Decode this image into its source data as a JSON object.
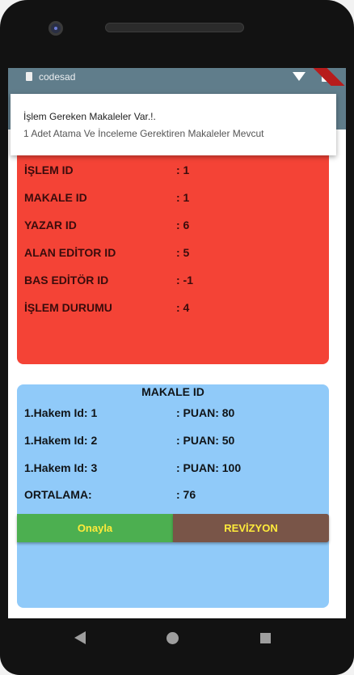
{
  "status_bar": {
    "app_name": "codesad",
    "icons": [
      "app-icon",
      "wifi-icon",
      "battery-icon"
    ]
  },
  "notification": {
    "title": "İşlem Gereken Makaleler Var.!.",
    "body": "1 Adet Atama Ve İnceleme Gerektiren  Makaleler Mevcut"
  },
  "process_card": {
    "color": "#f44336",
    "rows": [
      {
        "label": "İŞLEM ID",
        "value": ": 1"
      },
      {
        "label": "MAKALE ID",
        "value": ": 1"
      },
      {
        "label": "YAZAR ID",
        "value": ": 6"
      },
      {
        "label": "ALAN EDİTOR ID",
        "value": ": 5"
      },
      {
        "label": "BAS EDİTÖR ID",
        "value": ": -1"
      },
      {
        "label": "İŞLEM DURUMU",
        "value": ": 4"
      }
    ]
  },
  "review_card": {
    "color": "#90caf9",
    "title": "MAKALE ID",
    "rows": [
      {
        "label": "1.Hakem Id: 1",
        "value": ":  PUAN: 80"
      },
      {
        "label": "1.Hakem Id: 2",
        "value": ":  PUAN: 50"
      },
      {
        "label": "1.Hakem Id: 3",
        "value": ":  PUAN: 100"
      },
      {
        "label": "ORTALAMA:",
        "value": ": 76"
      }
    ],
    "buttons": {
      "approve_label": "Onayla",
      "revision_label": "REVİZYON"
    }
  },
  "nav_bar": {
    "icons": [
      "back-icon",
      "home-icon",
      "recents-icon"
    ]
  }
}
